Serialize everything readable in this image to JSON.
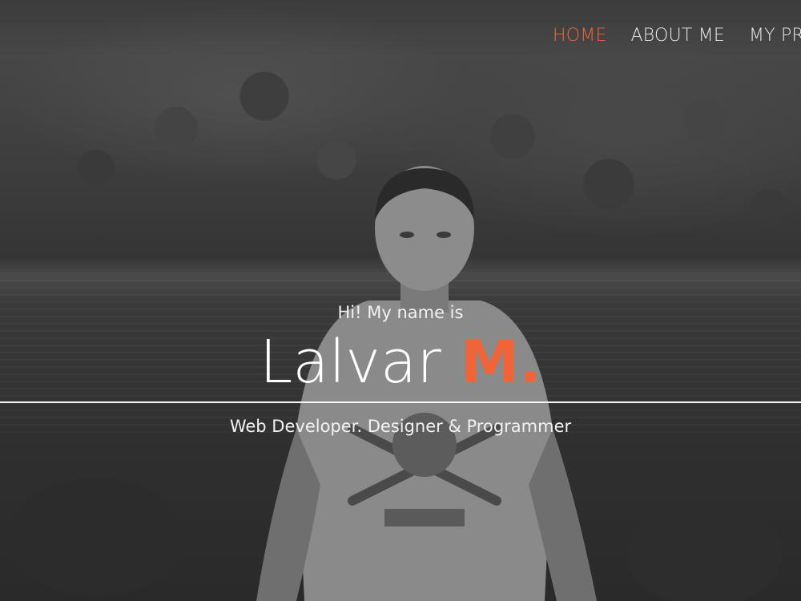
{
  "nav": {
    "items": [
      {
        "label": "HOME",
        "active": true
      },
      {
        "label": "ABOUT ME",
        "active": false
      },
      {
        "label": "MY PR",
        "active": false
      }
    ]
  },
  "hero": {
    "intro": "Hi! My name is",
    "first_name": "Lalvar",
    "last_name": "M.",
    "tagline": "Web Developer. Designer & Programmer"
  },
  "colors": {
    "accent": "#f0643a",
    "text": "#ffffff",
    "overlay": "#3a3a3a"
  }
}
